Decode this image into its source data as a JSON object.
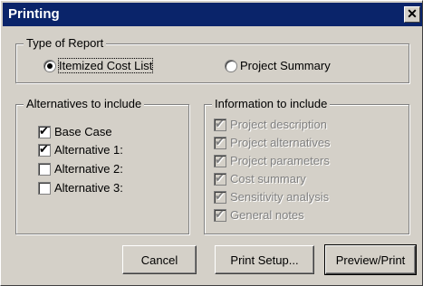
{
  "dialog": {
    "title": "Printing",
    "close_label": "✕"
  },
  "type_of_report": {
    "legend": "Type of Report",
    "options": [
      {
        "label": "Itemized Cost List",
        "selected": true
      },
      {
        "label": "Project Summary",
        "selected": false
      }
    ]
  },
  "alternatives": {
    "legend": "Alternatives to include",
    "items": [
      {
        "label": "Base Case",
        "checked": true
      },
      {
        "label": "Alternative 1:",
        "checked": true
      },
      {
        "label": "Alternative 2:",
        "checked": false
      },
      {
        "label": "Alternative 3:",
        "checked": false
      }
    ]
  },
  "information": {
    "legend": "Information to include",
    "items": [
      {
        "label": "Project description",
        "checked": true
      },
      {
        "label": "Project alternatives",
        "checked": true
      },
      {
        "label": "Project parameters",
        "checked": true
      },
      {
        "label": "Cost summary",
        "checked": true
      },
      {
        "label": "Sensitivity analysis",
        "checked": true
      },
      {
        "label": "General notes",
        "checked": true
      }
    ]
  },
  "buttons": {
    "cancel": "Cancel",
    "print_setup": "Print Setup...",
    "preview_print": "Preview/Print"
  }
}
